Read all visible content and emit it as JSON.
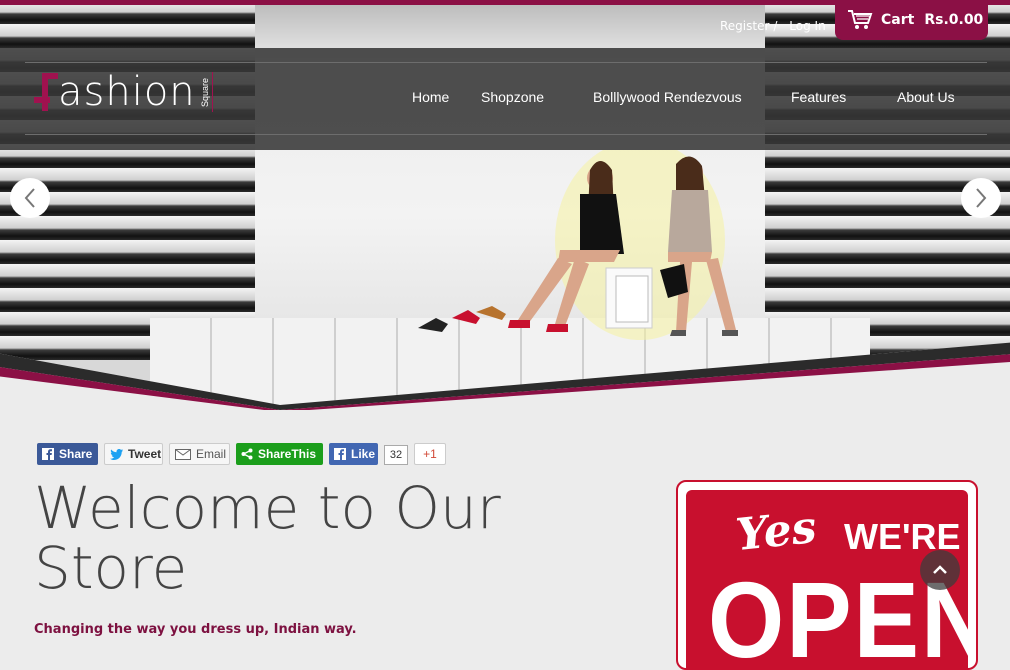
{
  "header": {
    "logo_text": "ashion",
    "logo_tag": "Square",
    "register_label": "Register",
    "separator": "/",
    "login_label": "Log In",
    "cart_label": "Cart",
    "cart_total": "Rs.0.00"
  },
  "nav": {
    "items": [
      {
        "label": "Home"
      },
      {
        "label": "Shopzone"
      },
      {
        "label": "Bolllywood Rendezvous"
      },
      {
        "label": "Features"
      },
      {
        "label": "About Us"
      }
    ]
  },
  "share_bar": {
    "facebook_share": "Share",
    "tweet": "Tweet",
    "email": "Email",
    "sharethis": "ShareThis",
    "like": "Like",
    "like_count": "32",
    "gplus": "+1"
  },
  "main": {
    "welcome_title": "Welcome to Our Store",
    "tagline": "Changing the way you dress up, Indian way."
  },
  "sign": {
    "yes": "Yes",
    "were": "WE'RE",
    "open": "OPEN"
  },
  "colors": {
    "brand": "#8b1045",
    "facebook": "#3b5998",
    "sharethis": "#1b9e1b",
    "sign_red": "#c8102e"
  },
  "icons": [
    "cart-icon",
    "chevron-left-icon",
    "chevron-right-icon",
    "facebook-icon",
    "twitter-icon",
    "email-icon",
    "share-icon",
    "chevron-up-icon"
  ]
}
